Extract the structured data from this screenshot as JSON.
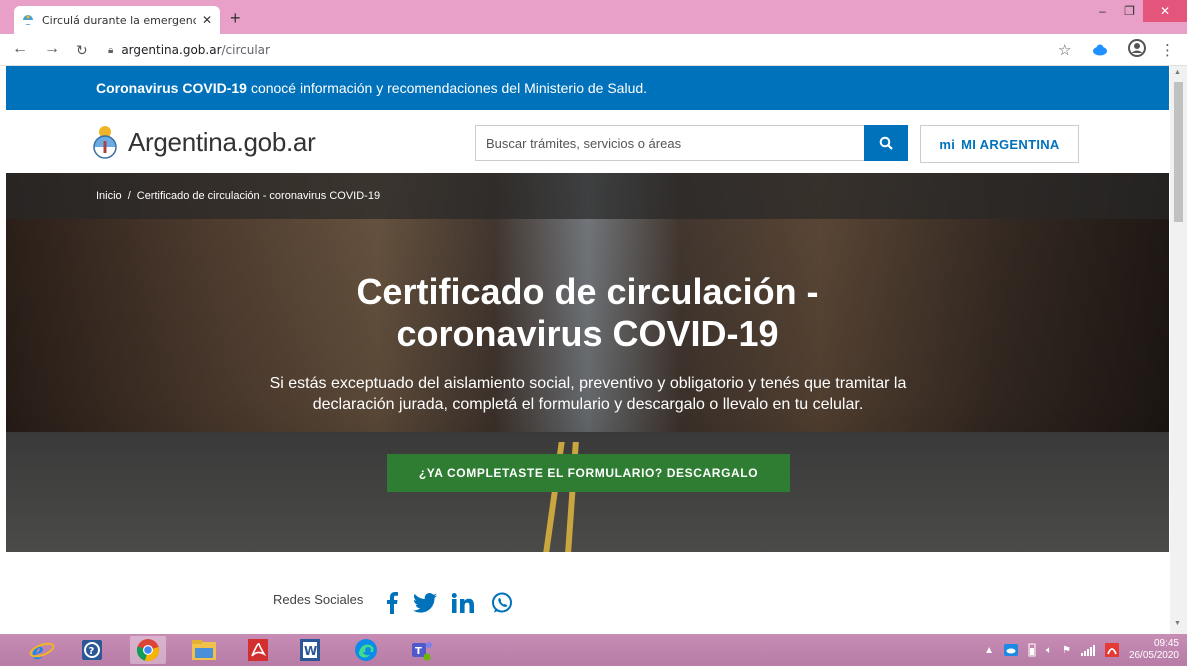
{
  "browser": {
    "tab_title": "Circulá durante la emergencia sa",
    "tab_close": "✕",
    "new_tab": "+",
    "url_host": "argentina.gob.ar",
    "url_path": "/circular"
  },
  "page": {
    "covid_banner": {
      "bold": "Coronavirus COVID-19",
      "text": "conocé información y recomendaciones del Ministerio de Salud."
    },
    "header": {
      "logo_text": "Argentina.gob.ar",
      "search_placeholder": "Buscar trámites, servicios o áreas",
      "mi_label": "mi",
      "mi_argentina": "MI ARGENTINA"
    },
    "breadcrumb": {
      "home": "Inicio",
      "separator": "/",
      "current": "Certificado de circulación - coronavirus COVID-19"
    },
    "hero": {
      "title_line1": "Certificado de circulación -",
      "title_line2": "coronavirus COVID-19",
      "description": "Si estás exceptuado del aislamiento social, preventivo y obligatorio y tenés que tramitar la declaración jurada, completá el formulario y descargalo o llevalo en tu celular.",
      "cta": "¿YA COMPLETASTE EL FORMULARIO? DESCARGALO"
    },
    "social": {
      "label": "Redes Sociales",
      "icons": [
        "facebook-icon",
        "twitter-icon",
        "linkedin-icon",
        "whatsapp-icon"
      ]
    }
  },
  "taskbar": {
    "time": "09:45",
    "date": "26/05/2020"
  },
  "colors": {
    "gov_blue": "#0072bb",
    "cta_green": "#2e7d32",
    "titlebar": "#e8a0c8"
  }
}
